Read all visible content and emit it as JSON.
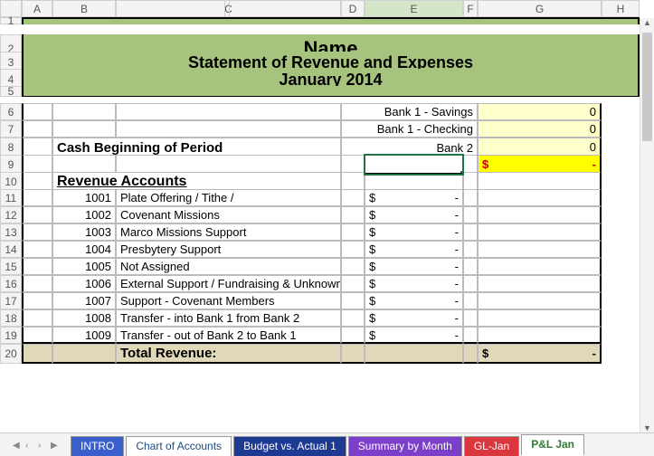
{
  "columns": [
    "A",
    "B",
    "C",
    "D",
    "E",
    "F",
    "G",
    "H"
  ],
  "active_col": "E",
  "rows": [
    "1",
    "2",
    "3",
    "4",
    "5",
    "6",
    "7",
    "8",
    "9",
    "10",
    "11",
    "12",
    "13",
    "14",
    "15",
    "16",
    "17",
    "18",
    "19",
    "20"
  ],
  "active_row": "9",
  "title": "Name",
  "subtitle": "Statement of Revenue and Expenses",
  "period": "January  2014",
  "banks": [
    {
      "label": "Bank 1 - Savings",
      "value": "0"
    },
    {
      "label": "Bank 1 - Checking",
      "value": "0"
    },
    {
      "label": "Bank 2",
      "value": "0"
    }
  ],
  "cash_beginning_label": "Cash Beginning of Period",
  "total_dash": {
    "sym": "$",
    "dash": "-"
  },
  "revenue_header": "Revenue Accounts",
  "revenue": [
    {
      "code": "1001",
      "name": "Plate Offering / Tithe /"
    },
    {
      "code": "1002",
      "name": "Covenant Missions"
    },
    {
      "code": "1003",
      "name": "Marco Missions Support"
    },
    {
      "code": "1004",
      "name": "Presbytery Support"
    },
    {
      "code": "1005",
      "name": "Not Assigned"
    },
    {
      "code": "1006",
      "name": "External Support / Fundraising & Unknown"
    },
    {
      "code": "1007",
      "name": "Support - Covenant Members"
    },
    {
      "code": "1008",
      "name": "Transfer - into Bank 1 from Bank 2"
    },
    {
      "code": "1009",
      "name": "Transfer - out of Bank 2 to Bank 1"
    }
  ],
  "total_revenue_label": "Total Revenue:",
  "tabs": {
    "intro": "INTRO",
    "coa": "Chart of Accounts",
    "budget": "Budget vs. Actual 1",
    "summary": "Summary by Month",
    "gl": "GL-Jan",
    "active": "P&L Jan"
  }
}
